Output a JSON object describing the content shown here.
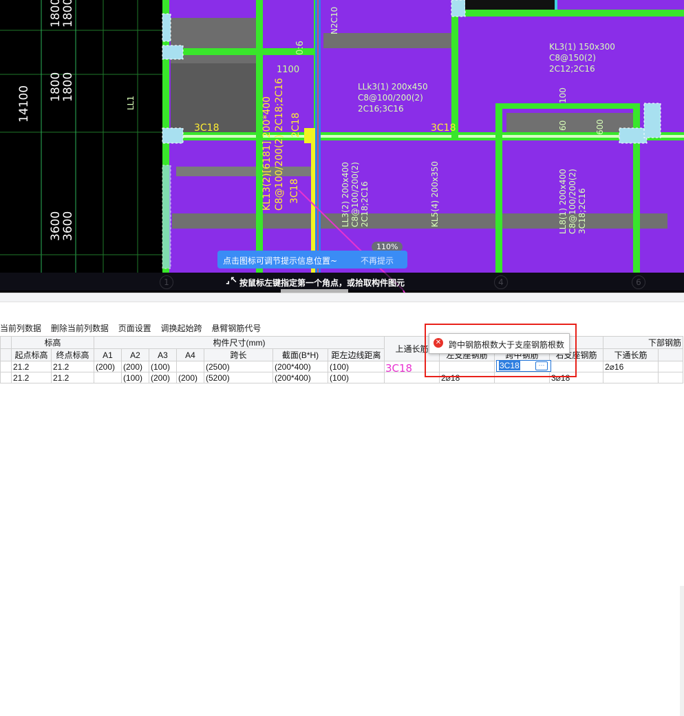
{
  "drawing": {
    "dims": [
      "1800",
      "1800",
      "14100",
      "1800",
      "1800",
      "3600",
      "3600"
    ],
    "beam_labels": [
      "N2C10",
      "LL1",
      "1100",
      "0:6",
      "3C18",
      "3C18",
      "LLk3(1) 200x450",
      "C8@100/200(2)",
      "2C16;3C16",
      "KL3(1) 150x300",
      "C8@150(2)",
      "2C12;2C16",
      "KL13(2)[6181] 200*400",
      "C8@100/200(2) 2C18;2C16",
      "3C18",
      "LL3(2) 200x400",
      "C8@100/200(2)",
      "2C18;2C16",
      "KL5(4) 200x350",
      "LL8(1) 200x400",
      "C8@100/200(2)",
      "3C18;2C16",
      "2C18",
      "100",
      "600",
      "60"
    ],
    "axis_numbers": [
      "1",
      "4",
      "6"
    ],
    "zoom": "110%",
    "hint_text": "点击图标可调节提示信息位置~",
    "hint_dismiss": "不再提示",
    "status_text": "按鼠标左键指定第一个角点，或拾取构件图元"
  },
  "toolbar": {
    "items": [
      "当前列数据",
      "删除当前列数据",
      "页面设置",
      "调换起始跨",
      "悬臂钢筋代号"
    ]
  },
  "table": {
    "group_headers": [
      "标高",
      "构件尺寸(mm)",
      "上通长筋",
      "下部钢筋"
    ],
    "sub_headers": [
      "起点标高",
      "终点标高",
      "A1",
      "A2",
      "A3",
      "A4",
      "跨长",
      "截面(B*H)",
      "距左边线距离",
      "",
      "左支座钢筋",
      "跨中钢筋",
      "右支座钢筋",
      "下通长筋",
      ""
    ],
    "rows": [
      [
        "21.2",
        "21.2",
        "(200)",
        "(200)",
        "(100)",
        "",
        "(2500)",
        "(200*400)",
        "(100)",
        "",
        "",
        "3C18",
        "",
        "2⌀16",
        ""
      ],
      [
        "21.2",
        "21.2",
        "",
        "(100)",
        "(200)",
        "(200)",
        "(5200)",
        "(200*400)",
        "(100)",
        "",
        "2⌀18",
        "",
        "3⌀18",
        "",
        ""
      ]
    ]
  },
  "error": {
    "message": "跨中钢筋根数大于支座钢筋根数",
    "edit_value": "3C18",
    "annotation": "3C18"
  },
  "colors": {
    "accent": "#3a8cf5",
    "error": "#e8211a",
    "room": "#8a2ee8",
    "beam": "#39e62b",
    "column": "#f2f222"
  }
}
